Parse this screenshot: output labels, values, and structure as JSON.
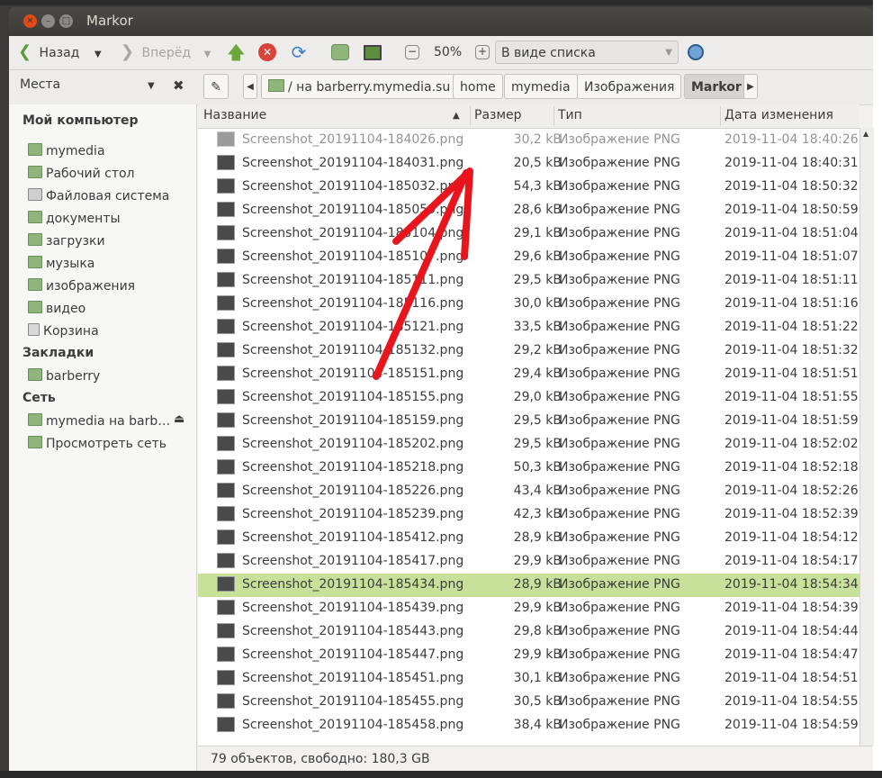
{
  "window": {
    "title": "Markor"
  },
  "toolbar": {
    "back": "Назад",
    "forward": "Вперёд",
    "zoom": "50%",
    "view_mode": "В виде списка"
  },
  "sidebar": {
    "title": "Места",
    "sections": [
      {
        "heading": "Мой компьютер",
        "items": [
          "mymedia",
          "Рабочий стол",
          "Файловая система",
          "документы",
          "загрузки",
          "музыка",
          "изображения",
          "видео",
          "Корзина"
        ]
      },
      {
        "heading": "Закладки",
        "items": [
          "barberry"
        ]
      },
      {
        "heading": "Сеть",
        "items": [
          "mymedia на barb…",
          "Просмотреть сеть"
        ]
      }
    ]
  },
  "breadcrumbs": [
    "/ на barberry.mymedia.su",
    "home",
    "mymedia",
    "Изображения",
    "Markor"
  ],
  "columns": {
    "name": "Название",
    "size": "Размер",
    "type": "Тип",
    "date": "Дата изменения"
  },
  "files": [
    {
      "name": "Screenshot_20191104-184026.png",
      "size": "30,2 kB",
      "type": "Изображение PNG",
      "date": "2019-11-04 18:40:26"
    },
    {
      "name": "Screenshot_20191104-184031.png",
      "size": "20,5 kB",
      "type": "Изображение PNG",
      "date": "2019-11-04 18:40:31"
    },
    {
      "name": "Screenshot_20191104-185032.png",
      "size": "54,3 kB",
      "type": "Изображение PNG",
      "date": "2019-11-04 18:50:32"
    },
    {
      "name": "Screenshot_20191104-185059.png",
      "size": "28,6 kB",
      "type": "Изображение PNG",
      "date": "2019-11-04 18:50:59"
    },
    {
      "name": "Screenshot_20191104-185104.png",
      "size": "29,1 kB",
      "type": "Изображение PNG",
      "date": "2019-11-04 18:51:04"
    },
    {
      "name": "Screenshot_20191104-185107.png",
      "size": "29,6 kB",
      "type": "Изображение PNG",
      "date": "2019-11-04 18:51:07"
    },
    {
      "name": "Screenshot_20191104-185111.png",
      "size": "29,5 kB",
      "type": "Изображение PNG",
      "date": "2019-11-04 18:51:11"
    },
    {
      "name": "Screenshot_20191104-185116.png",
      "size": "30,0 kB",
      "type": "Изображение PNG",
      "date": "2019-11-04 18:51:16"
    },
    {
      "name": "Screenshot_20191104-185121.png",
      "size": "33,5 kB",
      "type": "Изображение PNG",
      "date": "2019-11-04 18:51:22"
    },
    {
      "name": "Screenshot_20191104-185132.png",
      "size": "29,2 kB",
      "type": "Изображение PNG",
      "date": "2019-11-04 18:51:32"
    },
    {
      "name": "Screenshot_20191104-185151.png",
      "size": "29,4 kB",
      "type": "Изображение PNG",
      "date": "2019-11-04 18:51:51"
    },
    {
      "name": "Screenshot_20191104-185155.png",
      "size": "29,0 kB",
      "type": "Изображение PNG",
      "date": "2019-11-04 18:51:55"
    },
    {
      "name": "Screenshot_20191104-185159.png",
      "size": "29,5 kB",
      "type": "Изображение PNG",
      "date": "2019-11-04 18:51:59"
    },
    {
      "name": "Screenshot_20191104-185202.png",
      "size": "29,5 kB",
      "type": "Изображение PNG",
      "date": "2019-11-04 18:52:02"
    },
    {
      "name": "Screenshot_20191104-185218.png",
      "size": "50,3 kB",
      "type": "Изображение PNG",
      "date": "2019-11-04 18:52:18"
    },
    {
      "name": "Screenshot_20191104-185226.png",
      "size": "43,4 kB",
      "type": "Изображение PNG",
      "date": "2019-11-04 18:52:26"
    },
    {
      "name": "Screenshot_20191104-185239.png",
      "size": "42,3 kB",
      "type": "Изображение PNG",
      "date": "2019-11-04 18:52:39"
    },
    {
      "name": "Screenshot_20191104-185412.png",
      "size": "28,9 kB",
      "type": "Изображение PNG",
      "date": "2019-11-04 18:54:12"
    },
    {
      "name": "Screenshot_20191104-185417.png",
      "size": "29,9 kB",
      "type": "Изображение PNG",
      "date": "2019-11-04 18:54:17"
    },
    {
      "name": "Screenshot_20191104-185434.png",
      "size": "28,9 kB",
      "type": "Изображение PNG",
      "date": "2019-11-04 18:54:34",
      "selected": true
    },
    {
      "name": "Screenshot_20191104-185439.png",
      "size": "29,9 kB",
      "type": "Изображение PNG",
      "date": "2019-11-04 18:54:39"
    },
    {
      "name": "Screenshot_20191104-185443.png",
      "size": "29,8 kB",
      "type": "Изображение PNG",
      "date": "2019-11-04 18:54:44"
    },
    {
      "name": "Screenshot_20191104-185447.png",
      "size": "29,9 kB",
      "type": "Изображение PNG",
      "date": "2019-11-04 18:54:47"
    },
    {
      "name": "Screenshot_20191104-185451.png",
      "size": "30,1 kB",
      "type": "Изображение PNG",
      "date": "2019-11-04 18:54:51"
    },
    {
      "name": "Screenshot_20191104-185455.png",
      "size": "30,5 kB",
      "type": "Изображение PNG",
      "date": "2019-11-04 18:54:55"
    },
    {
      "name": "Screenshot_20191104-185458.png",
      "size": "38,4 kB",
      "type": "Изображение PNG",
      "date": "2019-11-04 18:54:59"
    }
  ],
  "status": "79 объектов, свободно: 180,3 GB",
  "colors": {
    "selection": "#c7e19a",
    "annotation_arrow": "#e8161c",
    "close_button": "#df4a16"
  }
}
